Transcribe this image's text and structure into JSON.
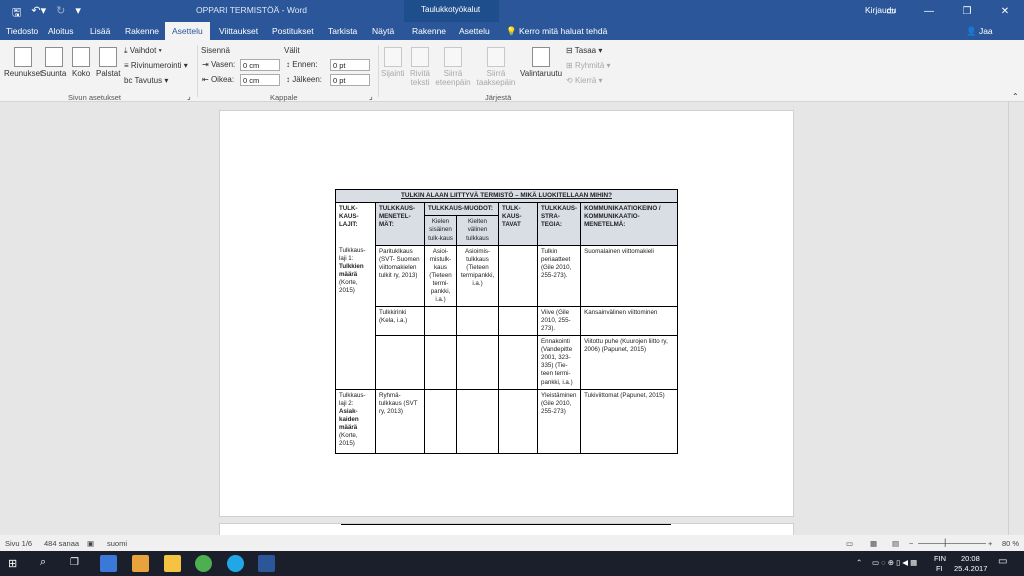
{
  "titlebar": {
    "doc_title": "OPPARI TERMISTÖÄ - Word",
    "context_title": "Taulukkotyökalut",
    "signin": "Kirjaudu"
  },
  "tabs": [
    "Tiedosto",
    "Aloitus",
    "Lisää",
    "Rakenne",
    "Asettelu",
    "Viittaukset",
    "Postitukset",
    "Tarkista",
    "Näytä",
    "Rakenne",
    "Asettelu"
  ],
  "tell_me": "Kerro mitä haluat tehdä",
  "share": "Jaa",
  "ribbon": {
    "page_setup": {
      "margins": "Reunukset",
      "orientation": "Suunta",
      "size": "Koko",
      "columns": "Palstat",
      "breaks": "Vaihdot",
      "line_numbers": "Rivinumerointi",
      "hyphenation": "Tavutus",
      "label": "Sivun asetukset"
    },
    "paragraph": {
      "indent_heading": "Sisennä",
      "spacing_heading": "Välit",
      "left_label": "Vasen:",
      "left_value": "0 cm",
      "right_label": "Oikea:",
      "right_value": "0 cm",
      "before_label": "Ennen:",
      "before_value": "0 pt",
      "after_label": "Jälkeen:",
      "after_value": "0 pt",
      "label": "Kappale"
    },
    "arrange": {
      "position": "Sijainti",
      "wrap": "Rivitä teksti",
      "forward": "Siirrä eteenpäin",
      "backward": "Siirrä taaksepäin",
      "selection_pane": "Valintaruutu",
      "align": "Tasaa",
      "group": "Ryhmitä",
      "rotate": "Kierrä",
      "label": "Järjestä"
    }
  },
  "document": {
    "table_title": "TULKIN ALAAN LIITTYVÄ TERMISTÖ – MIKÄ LUOKITELLAAN MIHIN?",
    "headers": {
      "types": "TULK-KAUS-LAJIT:",
      "methods": "TULKKAUS-MENETEL-MÄT:",
      "forms": "TULKKAUS-MUODOT:",
      "intra": "Kielen sisäinen tulk-kaus",
      "inter": "Kielten välinen tulkkaus",
      "styles": "TULK-KAUS-TAVAT",
      "strategies": "TULKKAUS-STRA-TEGIA:",
      "channels": "KOMMUNIKAATIOKEINO / KOMMUNIKAATIO-MENETELMÄ:"
    },
    "type1": {
      "prefix": "Tulkkaus-laji 1:",
      "bold": "Tulkkien määrä",
      "suffix": "(Korte, 2015)"
    },
    "type2": {
      "prefix": "Tulkkaus-laji 2:",
      "bold": "Asiak-kaiden määrä",
      "suffix": "(Korte, 2015)"
    },
    "rows": [
      {
        "method": "Parituklkaus (SVT- Suomen viittomakielen tulkit ry, 2013)",
        "intra": "Asioi-mistulk-kaus (Tieteen termi-pankki, i.a.)",
        "inter": "Asioimis-tulkkaus (Tieteen termipankki, i.a.)",
        "strategy": "Tulkin periaatteet (Gile 2010, 255-273).",
        "channel": "Suomalainen viittomakieli"
      },
      {
        "method": "Tulkkirinki (Kela, i.a.)",
        "strategy": "Viive (Gile 2010, 255-273).",
        "channel": "Kansainvälinen viittominen"
      },
      {
        "method": "",
        "strategy": "Ennakointi (Vandepitte 2001, 323-335) (Tie-teen termi-pankki, i.a.)",
        "channel": "Viitottu puhe (Kuurojen liitto ry, 2006) (Papunet, 2015)"
      },
      {
        "method": "Ryhmä-tulkkaus (SVT ry, 2013)",
        "strategy": "Yleistäminen (Gile 2010, 255-273)",
        "channel": "Tukiviittomat (Papunet, 2015)"
      }
    ]
  },
  "status": {
    "page": "Sivu 1/6",
    "words": "484 sanaa",
    "language": "suomi",
    "zoom": "80 %"
  },
  "taskbar": {
    "lang": "FIN",
    "lang2": "FI",
    "time": "20:08",
    "date": "25.4.2017"
  }
}
